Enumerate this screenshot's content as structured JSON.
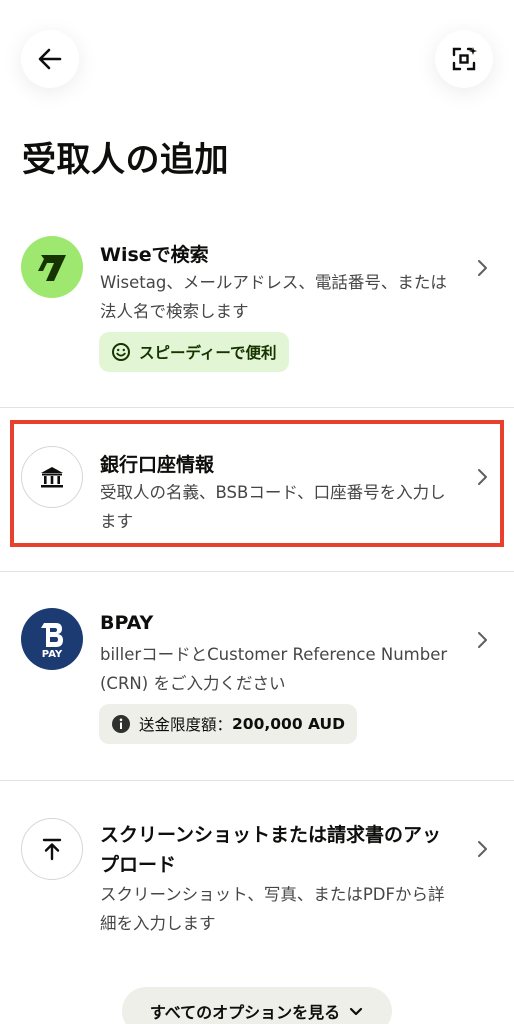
{
  "header": {
    "back_icon": "arrow-left-icon",
    "scan_icon": "scan-qr-icon"
  },
  "title": "受取人の追加",
  "items": [
    {
      "icon": "wise-logo-icon",
      "title": "Wiseで検索",
      "desc": "Wisetag、メールアドレス、電話番号、または法人名で検索します",
      "pill": "スピーディーで便利",
      "pill_icon": "smiley-icon",
      "accent": "#9fe870"
    },
    {
      "icon": "bank-icon",
      "title": "銀行口座情報",
      "desc": "受取人の名義、BSBコード、口座番号を入力します"
    },
    {
      "icon": "bpay-logo-icon",
      "logo_text": "PAY",
      "title": "BPAY",
      "desc": "billerコードとCustomer Reference Number (CRN) をご入力ください",
      "pill_label": "送金限度額：",
      "pill_value": "200,000 AUD",
      "pill_icon": "info-icon",
      "accent": "#1c3b72"
    },
    {
      "icon": "upload-icon",
      "title": "スクリーンショットまたは請求書のアップロード",
      "desc": "スクリーンショット、写真、またはPDFから詳細を入力します"
    }
  ],
  "see_all": "すべてのオプションを見る",
  "highlight_color": "#e8402c"
}
